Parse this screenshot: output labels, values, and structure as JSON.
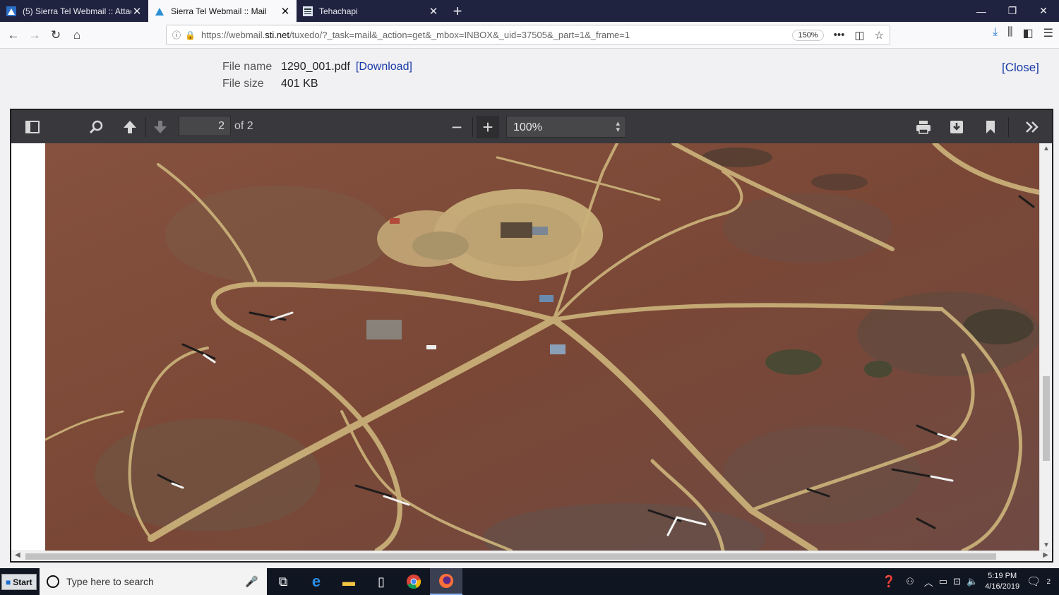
{
  "browser": {
    "tabs": [
      {
        "title": "(5) Sierra Tel Webmail :: Attachm",
        "active": false
      },
      {
        "title": "Sierra Tel Webmail :: Mail",
        "active": true
      },
      {
        "title": "Tehachapi",
        "active": false
      }
    ],
    "url_prefix": "https://webmail.",
    "url_domain": "sti.net",
    "url_rest": "/tuxedo/?_task=mail&_action=get&_mbox=INBOX&_uid=37505&_part=1&_frame=1",
    "zoom": "150%"
  },
  "attachment": {
    "file_name_label": "File name",
    "file_name": "1290_001.pdf",
    "download_label": "[Download]",
    "file_size_label": "File size",
    "file_size": "401 KB",
    "close_label": "[Close]"
  },
  "pdf_viewer": {
    "page_number": "2",
    "page_of": "of 2",
    "zoom": "100%"
  },
  "taskbar": {
    "start_label": "Start",
    "search_placeholder": "Type here to search",
    "time": "5:19 PM",
    "date": "4/16/2019",
    "notifications": "2"
  },
  "colors": {
    "terrain": "#7e4a3a",
    "roads": "#cbb27a",
    "brand_accent": "#1a6fd0"
  }
}
